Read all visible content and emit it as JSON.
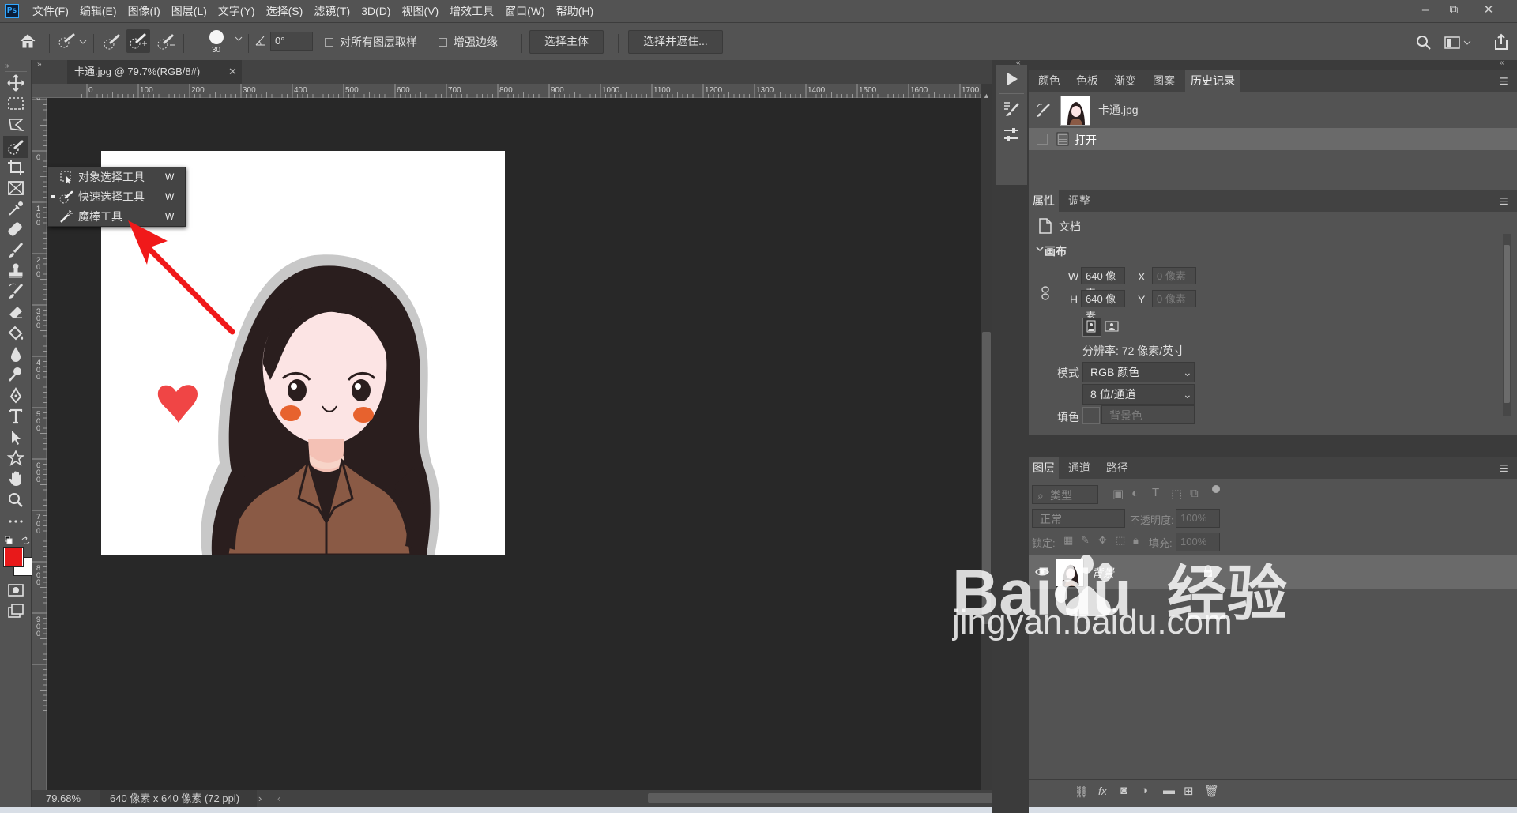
{
  "app": {
    "logo": "Ps"
  },
  "menu": [
    "文件(F)",
    "编辑(E)",
    "图像(I)",
    "图层(L)",
    "文字(Y)",
    "选择(S)",
    "滤镜(T)",
    "3D(D)",
    "视图(V)",
    "增效工具",
    "窗口(W)",
    "帮助(H)"
  ],
  "window_controls": {
    "minimize": "–",
    "restore": "⧉",
    "close": "✕"
  },
  "options": {
    "brush_size": "30",
    "angle": "0°",
    "sample_all_layers": "对所有图层取样",
    "enhance_edge": "增强边缘",
    "select_subject": "选择主体",
    "select_and_mask": "选择并遮住..."
  },
  "document": {
    "tab_title": "卡通.jpg @ 79.7%(RGB/8#)",
    "zoom": "79.68%",
    "doc_info": "640 像素 x 640 像素 (72 ppi)"
  },
  "ruler_top": [
    "0",
    "100",
    "200",
    "300",
    "400",
    "500",
    "600",
    "700",
    "800",
    "900",
    "1000",
    "1100",
    "1200",
    "1300",
    "1400",
    "1500",
    "1600",
    "1700"
  ],
  "ruler_left": [
    "0",
    "0",
    "1\n0\n0",
    "2\n0\n0",
    "3\n0\n0",
    "4\n0\n0",
    "5\n0\n0",
    "6\n0\n0",
    "7\n0\n0",
    "8\n0\n0",
    "9\n0\n0"
  ],
  "flyout": [
    {
      "label": "对象选择工具",
      "key": "W",
      "icon": "object-select-icon",
      "active": false
    },
    {
      "label": "快速选择工具",
      "key": "W",
      "icon": "quick-select-icon",
      "active": true
    },
    {
      "label": "魔棒工具",
      "key": "W",
      "icon": "magic-wand-icon",
      "active": false
    }
  ],
  "history_panel": {
    "tabs": [
      "颜色",
      "色板",
      "渐变",
      "图案",
      "历史记录"
    ],
    "active_tab": "历史记录",
    "snapshot": "卡通.jpg",
    "states": [
      "打开"
    ]
  },
  "properties_panel": {
    "tabs": [
      "属性",
      "调整"
    ],
    "active_tab": "属性",
    "doc_label": "文档",
    "section": "画布",
    "w_label": "W",
    "w_value": "640 像素",
    "h_label": "H",
    "h_value": "640 像素",
    "x_label": "X",
    "x_value": "0 像素",
    "y_label": "Y",
    "y_value": "0 像素",
    "resolution": "分辨率: 72 像素/英寸",
    "mode_label": "模式",
    "mode_value": "RGB 颜色",
    "depth_value": "8 位/通道",
    "fill_label": "填色",
    "fill_value": "背景色"
  },
  "layers_panel": {
    "tabs": [
      "图层",
      "通道",
      "路径"
    ],
    "active_tab": "图层",
    "filter_placeholder": "类型",
    "blend_mode": "正常",
    "opacity_label": "不透明度:",
    "opacity_value": "100%",
    "lock_label": "锁定:",
    "fill_label": "填充:",
    "fill_value": "100%",
    "layer_name": "背景"
  },
  "watermark": {
    "brand": "Baidu",
    "cn": "经验",
    "url": "jingyan.baidu.com"
  },
  "colors": {
    "foreground": "#e8191a",
    "background": "#ffffff",
    "accent_arrow": "#f0191a"
  }
}
